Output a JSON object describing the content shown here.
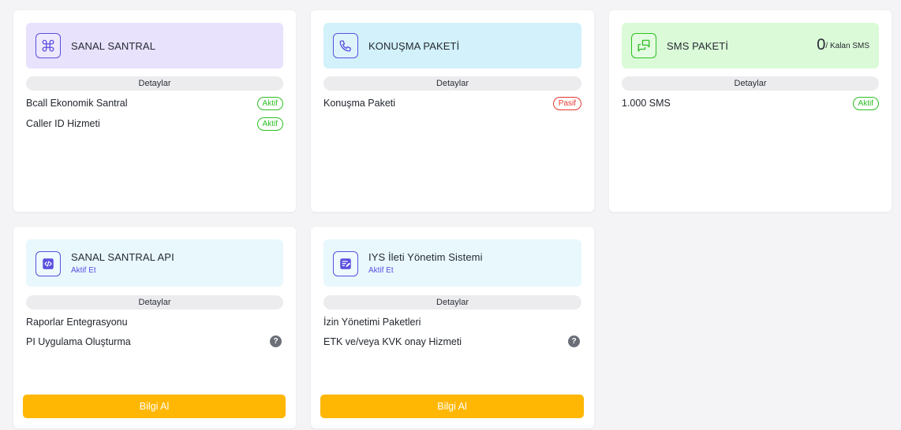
{
  "colors": {
    "page_bg": "#f4f4f6",
    "accent_indigo": "#5b4fe0",
    "active_green": "#2dbf22",
    "passive_red": "#e5372f",
    "cta_yellow": "#ffb703"
  },
  "cards": {
    "santral": {
      "icon": "command-icon",
      "title": "SANAL SANTRAL",
      "details_label": "Detaylar",
      "items": [
        {
          "label": "Bcall Ekonomik Santral",
          "status": "Aktif"
        },
        {
          "label": "Caller ID Hizmeti",
          "status": "Aktif"
        }
      ]
    },
    "konusma": {
      "icon": "phone-icon",
      "title": "KONUŞMA PAKETİ",
      "details_label": "Detaylar",
      "items": [
        {
          "label": "Konuşma Paketi",
          "status": "Pasif"
        }
      ]
    },
    "sms": {
      "icon": "chat-icon",
      "title": "SMS PAKETİ",
      "count": "0",
      "count_suffix": "/ Kalan SMS",
      "details_label": "Detaylar",
      "items": [
        {
          "label": "1.000 SMS",
          "status": "Aktif"
        }
      ]
    },
    "api": {
      "icon": "code-icon",
      "title": "SANAL SANTRAL API",
      "subtitle": "Aktif Et",
      "details_label": "Detaylar",
      "items": [
        {
          "label": "Raporlar Entegrasyonu"
        },
        {
          "label": "PI Uygulama Oluşturma",
          "help": "?"
        }
      ],
      "cta": "Bilgi Al"
    },
    "iys": {
      "icon": "edit-note-icon",
      "title": "IYS İleti Yönetim Sistemi",
      "subtitle": "Aktif Et",
      "details_label": "Detaylar",
      "items": [
        {
          "label": "İzin Yönetimi Paketleri"
        },
        {
          "label": "ETK ve/veya KVK onay Hizmeti",
          "help": "?"
        }
      ],
      "cta": "Bilgi Al"
    }
  }
}
